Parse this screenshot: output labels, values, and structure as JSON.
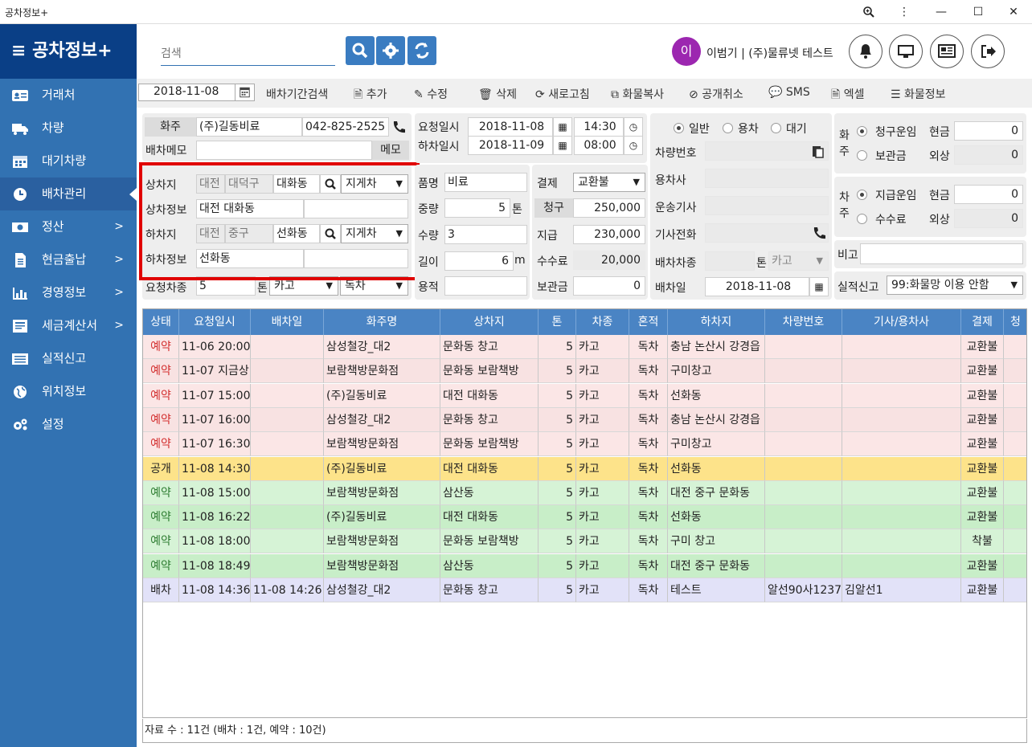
{
  "window": {
    "title": "공차정보+"
  },
  "sidebar": {
    "brand": "공차정보+",
    "items": [
      {
        "label": "거래처"
      },
      {
        "label": "차량"
      },
      {
        "label": "대기차량"
      },
      {
        "label": "배차관리"
      },
      {
        "label": "정산"
      },
      {
        "label": "현금출납"
      },
      {
        "label": "경영정보"
      },
      {
        "label": "세금계산서"
      },
      {
        "label": "실적신고"
      },
      {
        "label": "위치정보"
      },
      {
        "label": "설정"
      }
    ]
  },
  "header": {
    "search_placeholder": "검색",
    "avatar_initial": "이",
    "user": "이범기 | (주)물류넷 테스트"
  },
  "toolbar": {
    "date": "2018-11-08",
    "period_search": "배차기간검색",
    "add": "추가",
    "edit": "수정",
    "delete": "삭제",
    "refresh": "새로고침",
    "copy": "화물복사",
    "cancel_public": "공개취소",
    "sms": "SMS",
    "excel": "엑셀",
    "cargo_info": "화물정보"
  },
  "form": {
    "shipper_label": "화주",
    "shipper_name": "(주)길동비료",
    "shipper_phone": "042-825-2525",
    "memo_label": "배차메모",
    "memo_btn": "메모",
    "load_label": "상차지",
    "load_city": "대전",
    "load_district": "대덕구",
    "load_dong": "대화동",
    "load_equipment": "지게차",
    "load_info_label": "상차정보",
    "load_info": "대전 대화동",
    "unload_label": "하차지",
    "unload_city": "대전",
    "unload_district": "중구",
    "unload_dong": "선화동",
    "unload_equipment": "지게차",
    "unload_info_label": "하차정보",
    "unload_info": "선화동",
    "req_car_label": "요청차종",
    "req_ton": "5",
    "ton_label": "톤",
    "car_type": "카고",
    "mix": "독차",
    "req_date_label": "요청일시",
    "req_date": "2018-11-08",
    "req_time": "14:30",
    "unload_date_label": "하차일시",
    "unload_date": "2018-11-09",
    "unload_time": "08:00",
    "item_label": "품명",
    "item": "비료",
    "weight_label": "중량",
    "weight": "5",
    "weight_unit": "톤",
    "qty_label": "수량",
    "qty": "3",
    "length_label": "길이",
    "length": "6",
    "length_unit": "m",
    "volume_label": "용적",
    "pay_label": "결제",
    "pay": "교환불",
    "bill_label": "청구",
    "bill": "250,000",
    "give_label": "지급",
    "give": "230,000",
    "fee_label": "수수료",
    "fee": "20,000",
    "keep_label": "보관금",
    "keep": "0",
    "radio_normal": "일반",
    "radio_hire": "용차",
    "radio_wait": "대기",
    "car_no_label": "차량번호",
    "hire_co_label": "용차사",
    "driver_label": "운송기사",
    "driver_phone_label": "기사전화",
    "dispatch_car_label": "배차차종",
    "dispatch_ton_label": "톤",
    "dispatch_car": "카고",
    "dispatch_date_label": "배차일",
    "dispatch_date": "2018-11-08",
    "owner_label": "화주",
    "owner_bill_label": "청구운임",
    "owner_cash_label": "현금",
    "owner_cash": "0",
    "owner_keep_label": "보관금",
    "owner_credit_label": "외상",
    "owner_credit": "0",
    "car_owner_label": "차주",
    "pay_fare_label": "지급운임",
    "car_cash_label": "현금",
    "car_cash": "0",
    "car_fee_label": "수수료",
    "car_credit_label": "외상",
    "car_credit": "0",
    "note_label": "비고",
    "report_label": "실적신고",
    "report": "99:화물망 이용 안함"
  },
  "grid": {
    "headers": [
      "상태",
      "요청일시",
      "배차일",
      "화주명",
      "상차지",
      "톤",
      "차종",
      "혼적",
      "하차지",
      "차량번호",
      "기사/용차사",
      "결제",
      "청"
    ],
    "rows": [
      {
        "status": "예약",
        "req": "11-06 20:00",
        "disp": "",
        "shipper": "삼성철강_대2",
        "load": "문화동 창고",
        "ton": "5",
        "car": "카고",
        "mix": "독차",
        "unload": "충남 논산시 강경읍",
        "carno": "",
        "driver": "",
        "pay": "교환불",
        "bg": "#fbe6e6",
        "sc": "#d32f2f"
      },
      {
        "status": "예약",
        "req": "11-07 지금상",
        "disp": "",
        "shipper": "보람책방문화점",
        "load": "문화동 보람책방",
        "ton": "5",
        "car": "카고",
        "mix": "독차",
        "unload": "구미창고",
        "carno": "",
        "driver": "",
        "pay": "교환불",
        "bg": "#f8e2e2",
        "sc": "#d32f2f"
      },
      {
        "status": "예약",
        "req": "11-07 15:00",
        "disp": "",
        "shipper": "(주)길동비료",
        "load": "대전 대화동",
        "ton": "5",
        "car": "카고",
        "mix": "독차",
        "unload": "선화동",
        "carno": "",
        "driver": "",
        "pay": "교환불",
        "bg": "#fbe6e6",
        "sc": "#d32f2f"
      },
      {
        "status": "예약",
        "req": "11-07 16:00",
        "disp": "",
        "shipper": "삼성철강_대2",
        "load": "문화동 창고",
        "ton": "5",
        "car": "카고",
        "mix": "독차",
        "unload": "충남 논산시 강경읍",
        "carno": "",
        "driver": "",
        "pay": "교환불",
        "bg": "#f8e2e2",
        "sc": "#d32f2f"
      },
      {
        "status": "예약",
        "req": "11-07 16:30",
        "disp": "",
        "shipper": "보람책방문화점",
        "load": "문화동 보람책방",
        "ton": "5",
        "car": "카고",
        "mix": "독차",
        "unload": "구미창고",
        "carno": "",
        "driver": "",
        "pay": "교환불",
        "bg": "#fbe6e6",
        "sc": "#d32f2f"
      },
      {
        "status": "공개",
        "req": "11-08 14:30",
        "disp": "",
        "shipper": "(주)길동비료",
        "load": "대전 대화동",
        "ton": "5",
        "car": "카고",
        "mix": "독차",
        "unload": "선화동",
        "carno": "",
        "driver": "",
        "pay": "교환불",
        "bg": "#fde38a",
        "sc": "#222222"
      },
      {
        "status": "예약",
        "req": "11-08 15:00",
        "disp": "",
        "shipper": "보람책방문화점",
        "load": "삼산동",
        "ton": "5",
        "car": "카고",
        "mix": "독차",
        "unload": "대전 중구 문화동",
        "carno": "",
        "driver": "",
        "pay": "교환불",
        "bg": "#d6f3d6",
        "sc": "#2e7d32"
      },
      {
        "status": "예약",
        "req": "11-08 16:22",
        "disp": "",
        "shipper": "(주)길동비료",
        "load": "대전 대화동",
        "ton": "5",
        "car": "카고",
        "mix": "독차",
        "unload": "선화동",
        "carno": "",
        "driver": "",
        "pay": "교환불",
        "bg": "#c8eec8",
        "sc": "#2e7d32"
      },
      {
        "status": "예약",
        "req": "11-08 18:00",
        "disp": "",
        "shipper": "보람책방문화점",
        "load": "문화동 보람책방",
        "ton": "5",
        "car": "카고",
        "mix": "독차",
        "unload": "구미 창고",
        "carno": "",
        "driver": "",
        "pay": "착불",
        "bg": "#d6f3d6",
        "sc": "#2e7d32"
      },
      {
        "status": "예약",
        "req": "11-08 18:49",
        "disp": "",
        "shipper": "보람책방문화점",
        "load": "삼산동",
        "ton": "5",
        "car": "카고",
        "mix": "독차",
        "unload": "대전 중구 문화동",
        "carno": "",
        "driver": "",
        "pay": "교환불",
        "bg": "#c8eec8",
        "sc": "#2e7d32"
      },
      {
        "status": "배차",
        "req": "11-08 14:36",
        "disp": "11-08 14:26",
        "shipper": "삼성철강_대2",
        "load": "문화동 창고",
        "ton": "5",
        "car": "카고",
        "mix": "독차",
        "unload": "테스트",
        "carno": "알선90사1237",
        "driver": "김알선1",
        "pay": "교환불",
        "bg": "#e2e2f8",
        "sc": "#222222"
      }
    ]
  },
  "status_bar": "자료 수 : 11건 (배차 : 1건, 예약 : 10건)",
  "colors": {
    "sidebar": "#3272b2",
    "brand": "#0a3f86",
    "grid_header": "#4a84c4",
    "highlight": "#e00000"
  }
}
